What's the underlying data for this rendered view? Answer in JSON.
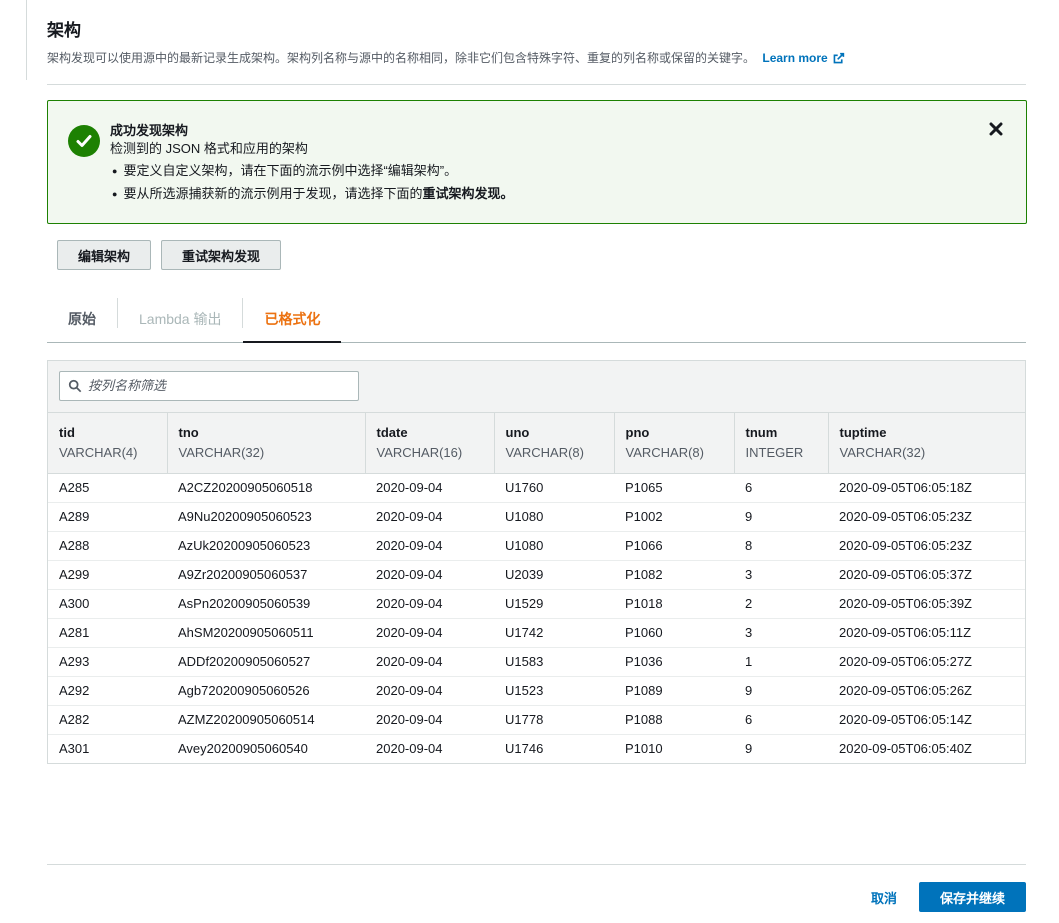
{
  "header": {
    "title": "架构",
    "description": "架构发现可以使用源中的最新记录生成架构。架构列名称与源中的名称相同，除非它们包含特殊字符、重复的列名称或保留的关键字。",
    "learn_more": "Learn more"
  },
  "alert": {
    "title": "成功发现架构",
    "line": "检测到的 JSON 格式和应用的架构",
    "bullet1": "要定义自定义架构，请在下面的流示例中选择“编辑架构”。",
    "bullet2_prefix": "要从所选源捕获新的流示例用于发现，请选择下面的",
    "bullet2_bold": "重试架构发现。",
    "status_color": "#1d8102"
  },
  "actions": {
    "edit_schema": "编辑架构",
    "retry_discovery": "重试架构发现"
  },
  "tabs": [
    {
      "label": "原始",
      "state": "normal"
    },
    {
      "label": "Lambda 输出",
      "state": "disabled"
    },
    {
      "label": "已格式化",
      "state": "active"
    }
  ],
  "filter": {
    "placeholder": "按列名称筛选"
  },
  "table": {
    "columns": [
      {
        "name": "tid",
        "type": "VARCHAR(4)"
      },
      {
        "name": "tno",
        "type": "VARCHAR(32)"
      },
      {
        "name": "tdate",
        "type": "VARCHAR(16)"
      },
      {
        "name": "uno",
        "type": "VARCHAR(8)"
      },
      {
        "name": "pno",
        "type": "VARCHAR(8)"
      },
      {
        "name": "tnum",
        "type": "INTEGER"
      },
      {
        "name": "tuptime",
        "type": "VARCHAR(32)"
      }
    ],
    "rows": [
      [
        "A285",
        "A2CZ20200905060518",
        "2020-09-04",
        "U1760",
        "P1065",
        "6",
        "2020-09-05T06:05:18Z"
      ],
      [
        "A289",
        "A9Nu20200905060523",
        "2020-09-04",
        "U1080",
        "P1002",
        "9",
        "2020-09-05T06:05:23Z"
      ],
      [
        "A288",
        "AzUk20200905060523",
        "2020-09-04",
        "U1080",
        "P1066",
        "8",
        "2020-09-05T06:05:23Z"
      ],
      [
        "A299",
        "A9Zr20200905060537",
        "2020-09-04",
        "U2039",
        "P1082",
        "3",
        "2020-09-05T06:05:37Z"
      ],
      [
        "A300",
        "AsPn20200905060539",
        "2020-09-04",
        "U1529",
        "P1018",
        "2",
        "2020-09-05T06:05:39Z"
      ],
      [
        "A281",
        "AhSM20200905060511",
        "2020-09-04",
        "U1742",
        "P1060",
        "3",
        "2020-09-05T06:05:11Z"
      ],
      [
        "A293",
        "ADDf20200905060527",
        "2020-09-04",
        "U1583",
        "P1036",
        "1",
        "2020-09-05T06:05:27Z"
      ],
      [
        "A292",
        "Agb720200905060526",
        "2020-09-04",
        "U1523",
        "P1089",
        "9",
        "2020-09-05T06:05:26Z"
      ],
      [
        "A282",
        "AZMZ20200905060514",
        "2020-09-04",
        "U1778",
        "P1088",
        "6",
        "2020-09-05T06:05:14Z"
      ],
      [
        "A301",
        "Avey20200905060540",
        "2020-09-04",
        "U1746",
        "P1010",
        "9",
        "2020-09-05T06:05:40Z"
      ]
    ]
  },
  "footer": {
    "cancel": "取消",
    "save_continue": "保存并继续"
  },
  "colors": {
    "accent_tab": "#ec7211",
    "primary_button": "#0073bb",
    "link": "#0073bb"
  }
}
